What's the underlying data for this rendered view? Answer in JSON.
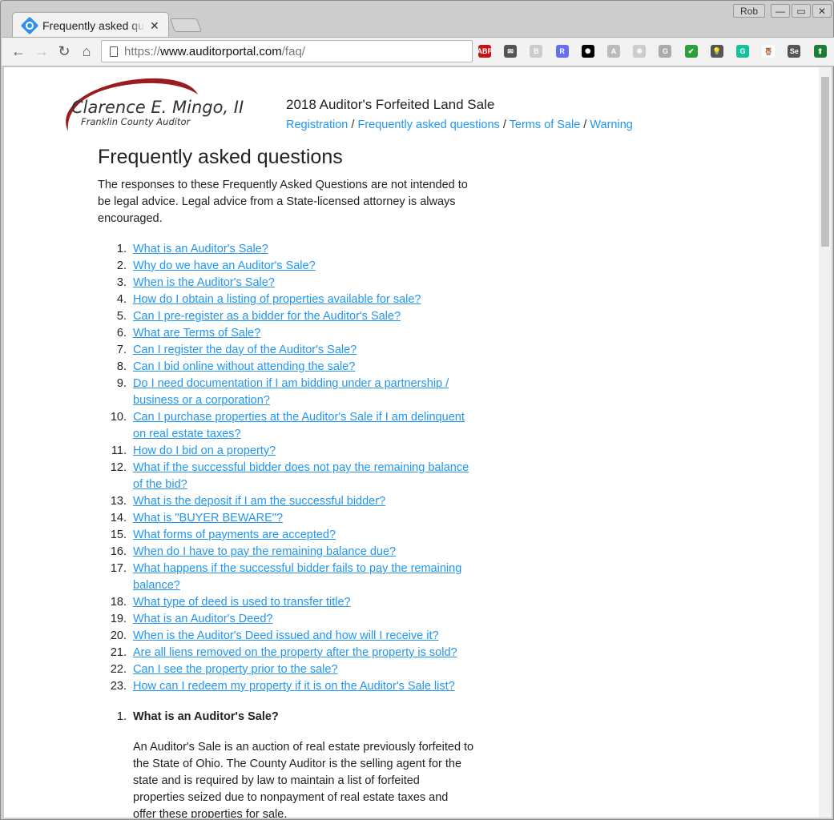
{
  "browser": {
    "tab_title": "Frequently asked questions",
    "user": "Rob",
    "url_scheme": "https://",
    "url_host": "www.auditorportal.com",
    "url_path": "/faq/",
    "extensions": [
      {
        "name": "adblock-plus",
        "label": "ABP",
        "color": "#c4141a"
      },
      {
        "name": "mail",
        "label": "✉",
        "color": "#555555"
      },
      {
        "name": "b",
        "label": "B",
        "color": "#cccccc"
      },
      {
        "name": "r",
        "label": "R",
        "color": "#6670e8"
      },
      {
        "name": "star",
        "label": "✺",
        "color": "#000000"
      },
      {
        "name": "ad",
        "label": "A",
        "color": "#bbbbbb"
      },
      {
        "name": "snow",
        "label": "❄",
        "color": "#cccccc"
      },
      {
        "name": "g",
        "label": "G",
        "color": "#aaaaaa"
      },
      {
        "name": "check",
        "label": "✔",
        "color": "#2e9e3e"
      },
      {
        "name": "bulb",
        "label": "💡",
        "color": "#555555"
      },
      {
        "name": "grammarly",
        "label": "G",
        "color": "#15c39a"
      },
      {
        "name": "owl",
        "label": "🦉",
        "color": "#ffffff"
      },
      {
        "name": "selenium",
        "label": "Se",
        "color": "#555555"
      },
      {
        "name": "upload",
        "label": "⬆",
        "color": "#1e7d32"
      }
    ]
  },
  "header": {
    "logo_name": "Clarence E. Mingo, II",
    "logo_sub": "Franklin County Auditor",
    "site_title": "2018 Auditor's Forfeited Land Sale",
    "nav": [
      "Registration",
      "Frequently asked questions",
      "Terms of Sale",
      "Warning"
    ]
  },
  "main": {
    "title": "Frequently asked questions",
    "intro": "The responses to these Frequently Asked Questions are not intended to be legal advice. Legal advice from a State-licensed attorney is always encouraged.",
    "questions": [
      "What is an Auditor's Sale?",
      "Why do we have an Auditor's Sale?",
      "When is the Auditor's Sale?",
      "How do I obtain a listing of properties available for sale?",
      "Can I pre-register as a bidder for the Auditor's Sale?",
      "What are Terms of Sale?",
      "Can I register the day of the Auditor's Sale?",
      "Can I bid online without attending the sale?",
      "Do I need documentation if I am bidding under a partnership / business or a corporation?",
      "Can I purchase properties at the Auditor's Sale if I am delinquent on real estate taxes?",
      "How do I bid on a property?",
      "What if the successful bidder does not pay the remaining balance of the bid?",
      "What is the deposit if I am the successful bidder?",
      "What is \"BUYER BEWARE\"?",
      "What forms of payments are accepted?",
      "When do I have to pay the remaining balance due?",
      "What happens if the successful bidder fails to pay the remaining balance?",
      "What type of deed is used to transfer title?",
      "What is an Auditor's Deed?",
      "When is the Auditor's Deed issued and how will I receive it?",
      "Are all liens removed on the property after the property is sold?",
      "Can I see the property prior to the sale?",
      "How can I redeem my property if it is on the Auditor's Sale list?"
    ],
    "answers": [
      {
        "question": "What is an Auditor's Sale?",
        "answer": "An Auditor's Sale is an auction of real estate previously forfeited to the State of Ohio. The County Auditor is the selling agent for the state and is required by law to maintain a list of forfeited properties seized due to nonpayment of real estate taxes and offer these properties for sale."
      }
    ]
  }
}
